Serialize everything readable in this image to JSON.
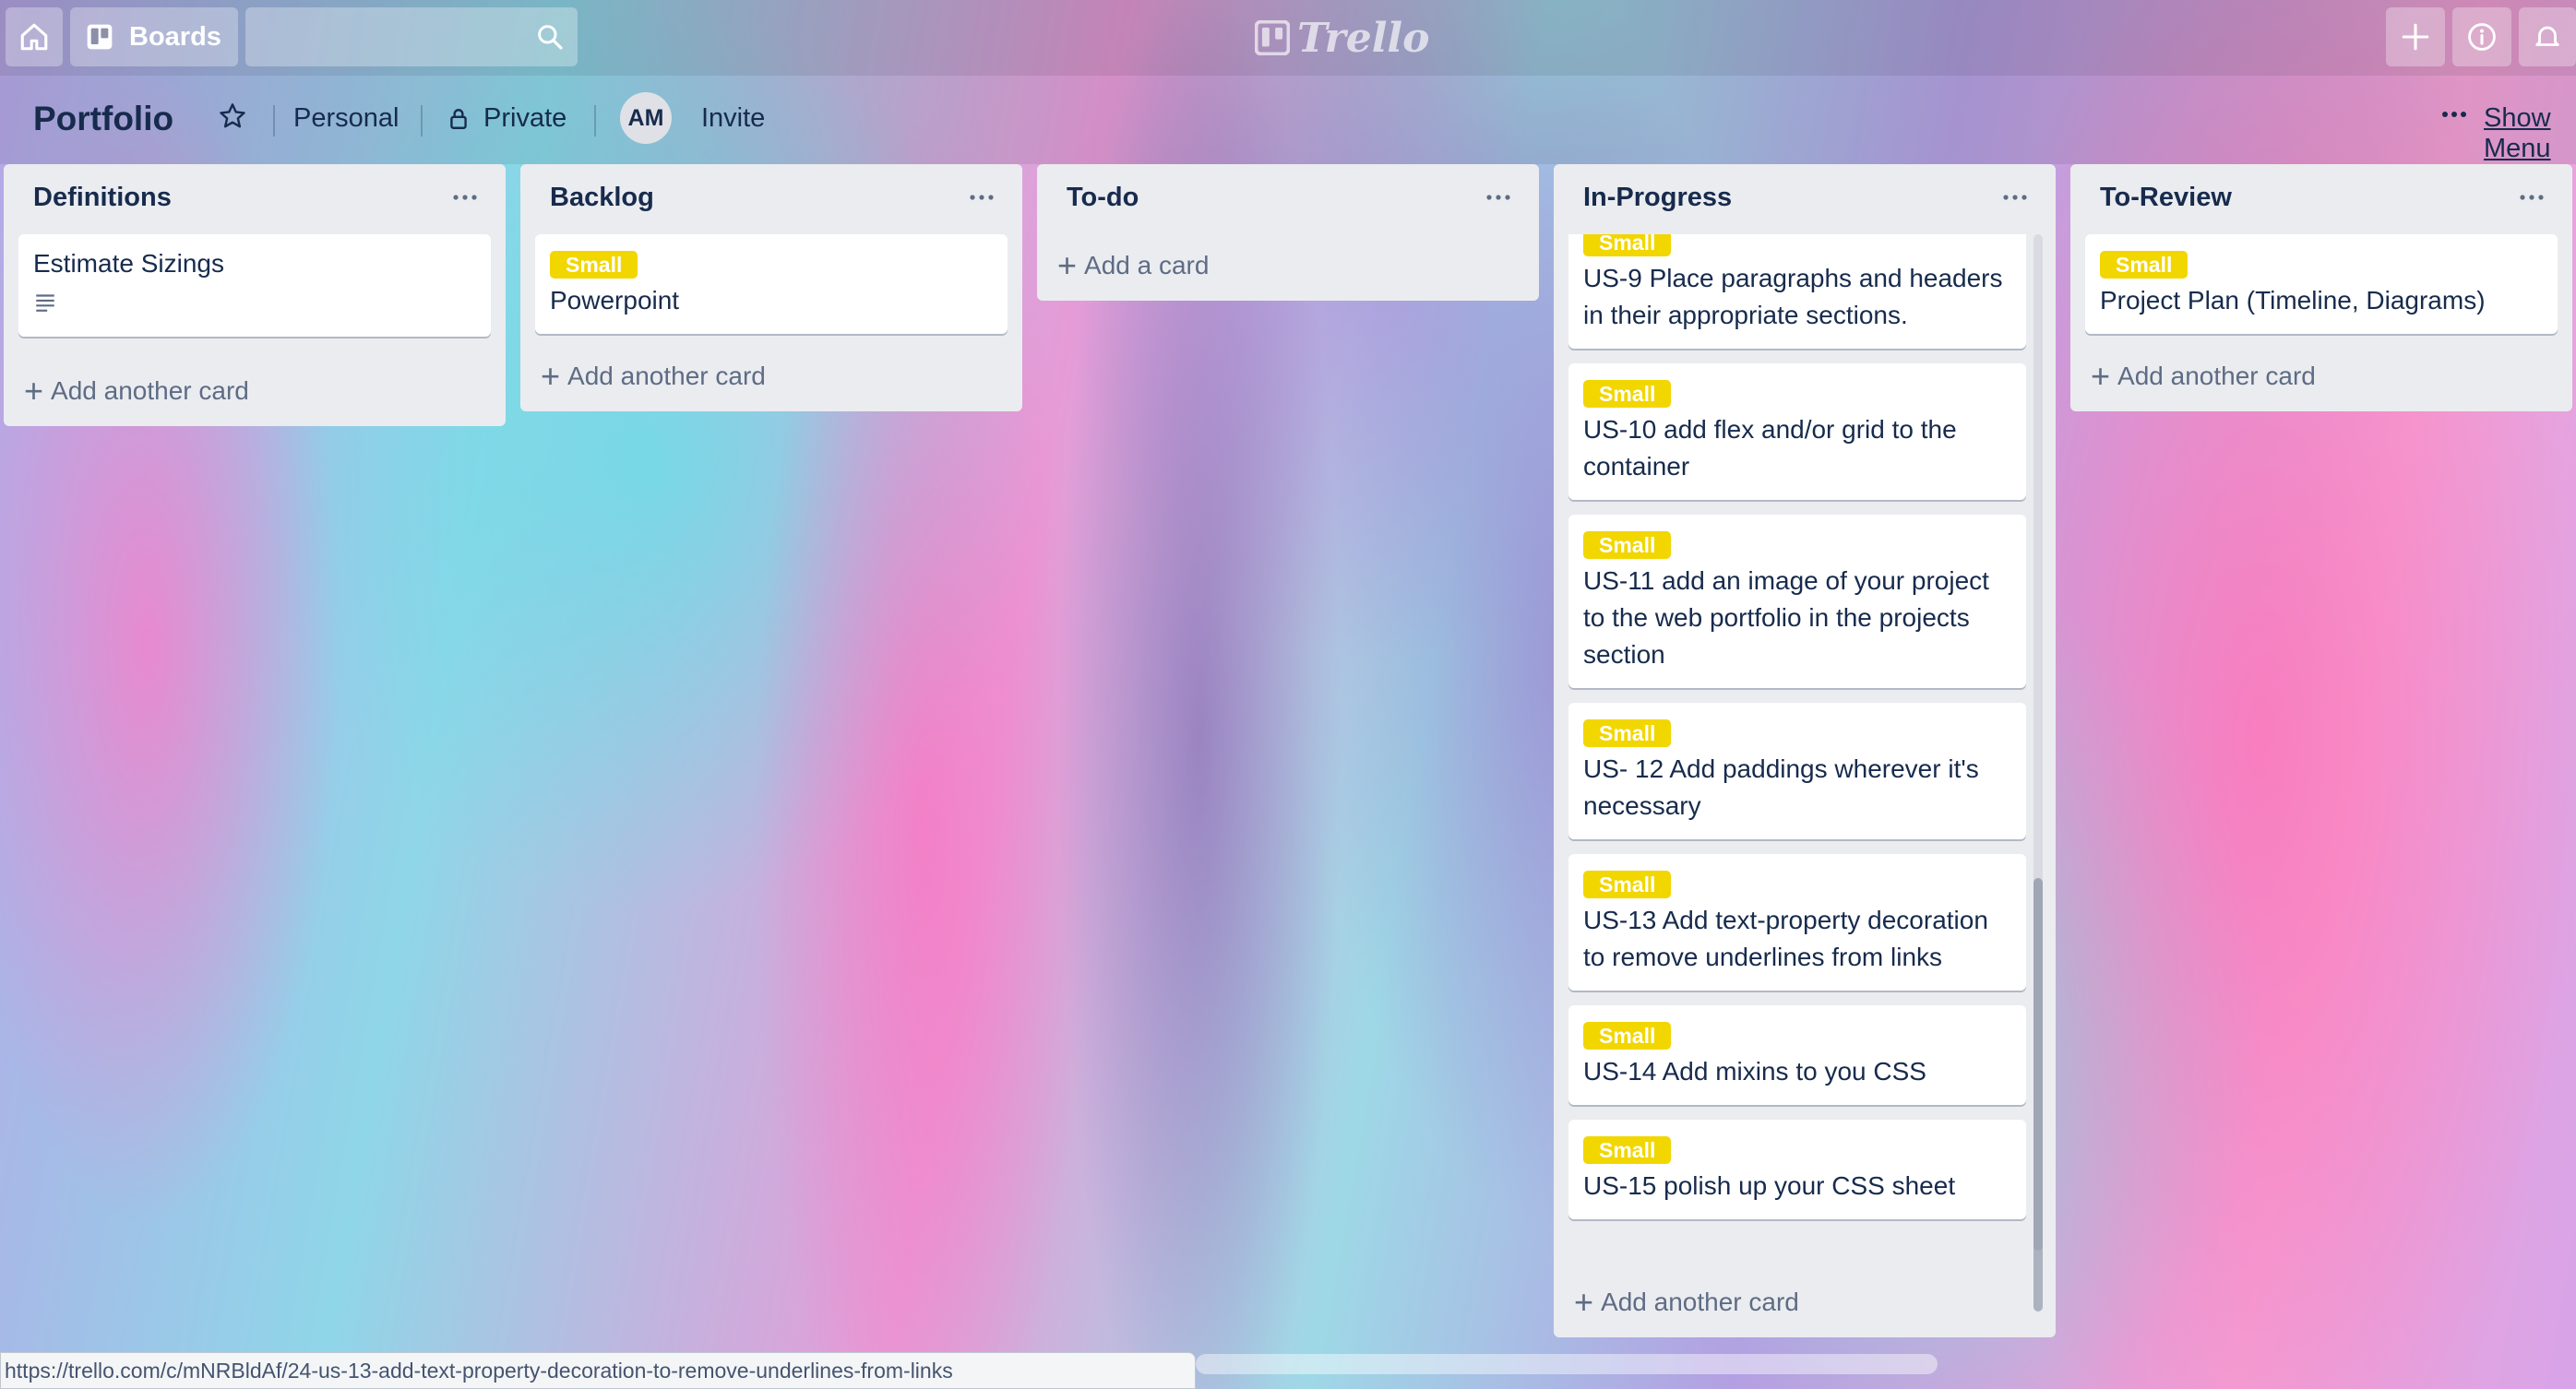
{
  "topbar": {
    "boards_label": "Boards",
    "logo_text": "Trello",
    "search_placeholder": ""
  },
  "board": {
    "title": "Portfolio",
    "team": "Personal",
    "visibility": "Private",
    "avatar_initials": "AM",
    "invite_label": "Invite",
    "show_menu_label": "Show Menu"
  },
  "lists": {
    "definitions": {
      "title": "Definitions",
      "cards": [
        {
          "text": "Estimate Sizings"
        }
      ],
      "add_label": "Add another card"
    },
    "backlog": {
      "title": "Backlog",
      "cards": [
        {
          "label": "Small",
          "text": "Powerpoint"
        }
      ],
      "add_label": "Add another card"
    },
    "todo": {
      "title": "To-do",
      "add_label": "Add a card"
    },
    "in_progress": {
      "title": "In-Progress",
      "cards": [
        {
          "label": "Small",
          "text": "US-9 Place paragraphs and headers in their appropriate sections."
        },
        {
          "label": "Small",
          "text": "US-10 add flex and/or grid to the container"
        },
        {
          "label": "Small",
          "text": "US-11 add an image of your project to the web portfolio in the projects section"
        },
        {
          "label": "Small",
          "text": "US- 12 Add paddings wherever it's necessary"
        },
        {
          "label": "Small",
          "text": "US-13 Add text-property decoration to remove underlines from links"
        },
        {
          "label": "Small",
          "text": "US-14 Add mixins to you CSS"
        },
        {
          "label": "Small",
          "text": "US-15 polish up your CSS sheet"
        }
      ],
      "add_label": "Add another card"
    },
    "to_review": {
      "title": "To-Review",
      "cards": [
        {
          "label": "Small",
          "text": "Project Plan (Timeline, Diagrams)"
        }
      ],
      "add_label": "Add another card"
    }
  },
  "label_color": "#f2d600",
  "status_url": "https://trello.com/c/mNRBldAf/24-us-13-add-text-property-decoration-to-remove-underlines-from-links"
}
